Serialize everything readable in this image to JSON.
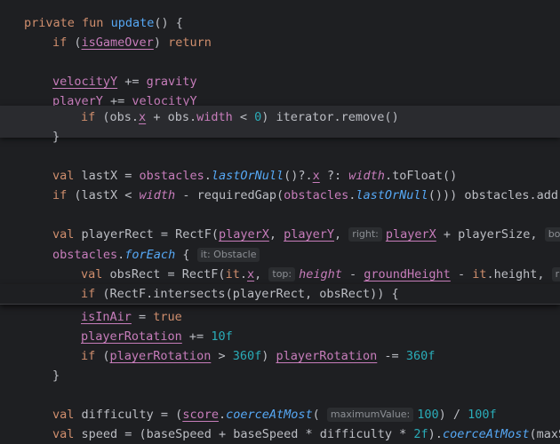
{
  "editor": {
    "language": "Kotlin",
    "colors": {
      "background": "#1e1f22",
      "keyword": "#cf8e6d",
      "function": "#56a8f5",
      "property": "#c77dbb",
      "number": "#2aacb8",
      "text": "#bcbec4",
      "hint_bg": "#2b2d30"
    },
    "tokens": {
      "private": "private",
      "fun": "fun",
      "update": "update",
      "paren_brace": "() {",
      "if": "if",
      "isGameOver": "isGameOver",
      "return": "return",
      "velocityY": "velocityY",
      "plus_assign": " += ",
      "gravity": "gravity",
      "playerY": "playerY",
      "obs_x_line": " (obs.",
      "x": "x",
      "plus_obs": " + obs.",
      "width": "width",
      "lt_zero": " < ",
      "zero": "0",
      "iterator_remove": ") iterator.remove()",
      "close_brace": "}",
      "val": "val",
      "lastX": " lastX = ",
      "obstacles": "obstacles",
      "dot": ".",
      "lastOrNull": "lastOrNull",
      "qx": "()?.",
      "elvis": " ?: ",
      "toFloat": ".toFloat()",
      "if_lastX": " (lastX < ",
      "minus_required": " - requiredGap(",
      "open_paren": "(",
      "closing_add": "())) obstacles.add(g",
      "playerRect": " playerRect = RectF(",
      "playerX": "playerX",
      "comma": ", ",
      "playerSize": " + playerSize, ",
      "forEach": "forEach",
      "brace_open": " {",
      "obsRect": " obsRect = RectF(",
      "it": "it",
      "height": "height",
      "groundHeight": "groundHeight",
      "minus": " - ",
      "it_height": ".height, ",
      "intersects": " (RectF.intersects(playerRect, obsRect)) {",
      "isInAir": "isInAir",
      "eq": " = ",
      "true": "true",
      "playerRotation": "playerRotation",
      "ten": "10f",
      "gt": " > ",
      "f360": "360f",
      "close_paren": ") ",
      "minus_assign": " -= ",
      "difficulty": " difficulty = (",
      "score": "score",
      "coerceAtMost": "coerceAtMost",
      "hundred": "100",
      "div": ") / ",
      "hundredf": "100f",
      "speed": " speed = (baseSpeed + baseSpeed * difficulty * ",
      "twof": "2f",
      "close_dot": ").",
      "maxSp": "(maxSp"
    },
    "hints": {
      "right": "right:",
      "bot": "bot",
      "it_obstacle": "it: Obstacle",
      "top": "top:",
      "ri": "ri",
      "maximumValue": "maximumValue:"
    }
  }
}
